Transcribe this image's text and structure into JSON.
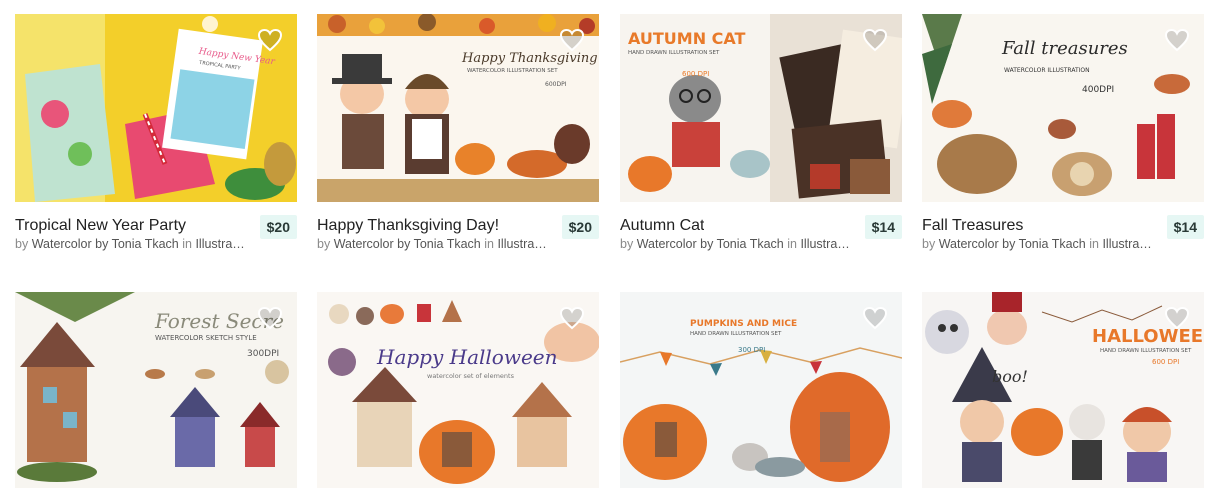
{
  "colors": {
    "price_bg": "#e6f7f4",
    "heart": "#ffffff"
  },
  "products": [
    {
      "title": "Tropical New Year Party",
      "price": "$20",
      "by": "by",
      "author": "Watercolor by Tonia Tkach",
      "in": "in",
      "category": "Illustra…",
      "thumb": {
        "heading": "Happy New Year",
        "sub": "TROPICAL PARTY"
      }
    },
    {
      "title": "Happy Thanksgiving Day!",
      "price": "$20",
      "by": "by",
      "author": "Watercolor by Tonia Tkach",
      "in": "in",
      "category": "Illustra…",
      "thumb": {
        "heading": "Happy Thanksgiving",
        "sub": "WATERCOLOR ILLUSTRATION SET",
        "dpi": "600DPI"
      }
    },
    {
      "title": "Autumn Cat",
      "price": "$14",
      "by": "by",
      "author": "Watercolor by Tonia Tkach",
      "in": "in",
      "category": "Illustra…",
      "thumb": {
        "heading": "AUTUMN CAT",
        "sub": "HAND DRAWN ILLUSTRATION SET",
        "dpi": "600 DPI"
      }
    },
    {
      "title": "Fall Treasures",
      "price": "$14",
      "by": "by",
      "author": "Watercolor by Tonia Tkach",
      "in": "in",
      "category": "Illustra…",
      "thumb": {
        "heading": "Fall treasures",
        "sub": "WATERCOLOR ILLUSTRATION",
        "dpi": "400DPI"
      }
    },
    {
      "title": "",
      "price": "",
      "by": "",
      "author": "",
      "in": "",
      "category": "",
      "thumb": {
        "heading": "Forest Secre",
        "sub": "WATERCOLOR SKETCH STYLE",
        "dpi": "300DPI"
      }
    },
    {
      "title": "",
      "price": "",
      "by": "",
      "author": "",
      "in": "",
      "category": "",
      "thumb": {
        "heading": "Happy Halloween",
        "sub": "watercolor set of elements"
      }
    },
    {
      "title": "",
      "price": "",
      "by": "",
      "author": "",
      "in": "",
      "category": "",
      "thumb": {
        "heading": "PUMPKINS AND MICE",
        "sub": "HAND DRAWN ILLUSTRATION SET",
        "dpi": "300 DPI"
      }
    },
    {
      "title": "",
      "price": "",
      "by": "",
      "author": "",
      "in": "",
      "category": "",
      "thumb": {
        "heading": "HALLOWEEN",
        "sub": "HAND DRAWN ILLUSTRATION SET",
        "dpi": "600 DPI"
      }
    }
  ]
}
